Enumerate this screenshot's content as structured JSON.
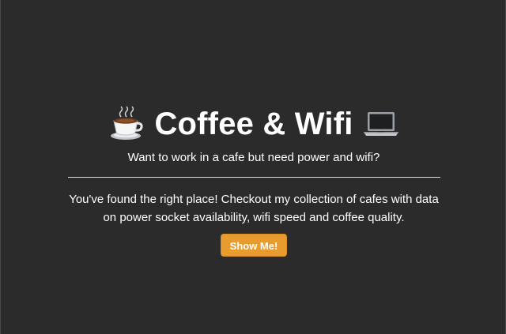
{
  "hero": {
    "title_icon_left": "coffee-cup-icon",
    "title_icon_right": "laptop-icon",
    "title": "Coffee & Wifi",
    "subtitle": "Want to work in a cafe but need power and wifi?",
    "description": "You've found the right place! Checkout my collection of cafes with data on power socket availability, wifi speed and coffee quality.",
    "cta_label": "Show Me!"
  },
  "colors": {
    "background": "#2b2b2b",
    "text": "#ffffff",
    "divider": "#dcdcdc",
    "button": "#e89c2f"
  }
}
